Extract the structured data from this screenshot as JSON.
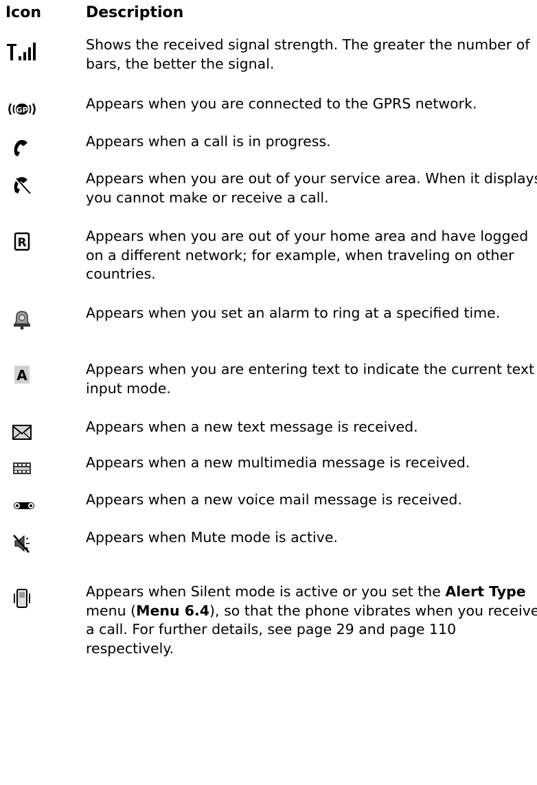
{
  "header": {
    "icon": "Icon",
    "description": "Description"
  },
  "rows": [
    {
      "icon": "signal-strength-icon",
      "text": "Shows the received signal strength. The greater the number of bars, the better the signal."
    },
    {
      "icon": "gprs-icon",
      "icon_text": "GP",
      "text": "Appears when you are connected to the GPRS network."
    },
    {
      "icon": "call-in-progress-icon",
      "text": "Appears when a call is in progress."
    },
    {
      "icon": "no-service-icon",
      "text": "Appears when you are out of your service area. When it displays, you cannot make or receive a call."
    },
    {
      "icon": "roaming-icon",
      "icon_text": "R",
      "text": "Appears when you are out of your home area and have logged on a different network; for example, when traveling on other countries."
    },
    {
      "icon": "alarm-icon",
      "text": "Appears when you set an alarm to ring at a specified time."
    },
    {
      "icon": "text-input-mode-icon",
      "icon_text": "A",
      "text": "Appears when you are entering text to indicate the current text input mode."
    },
    {
      "icon": "text-message-icon",
      "text": "Appears when a new text message is received."
    },
    {
      "icon": "multimedia-message-icon",
      "text": "Appears when a new multimedia message is received."
    },
    {
      "icon": "voice-mail-icon",
      "text": "Appears when a new voice mail message is received."
    },
    {
      "icon": "mute-icon",
      "text": "Appears when Mute mode is active."
    },
    {
      "icon": "silent-vibrate-icon",
      "text_parts": {
        "p1": "Appears when Silent mode is active or you set the ",
        "b1": "Alert Type",
        "p2": " menu (",
        "b2": "Menu 6.4",
        "p3": "), so that the phone vibrates when you receive a call. For further details, see page 29 and page 110 respectively."
      }
    }
  ]
}
